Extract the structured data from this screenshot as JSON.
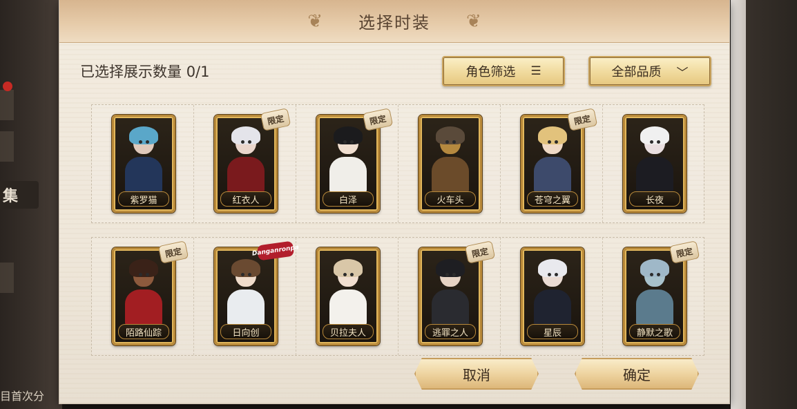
{
  "background": {
    "side_tab": "集",
    "bottom_text": "目首次分"
  },
  "dialog": {
    "title": "选择时装",
    "selected_label": "已选择展示数量",
    "selected_count": "0/1",
    "filter_button": "角色筛选",
    "quality_dropdown": "全部品质",
    "cancel": "取消",
    "confirm": "确定"
  },
  "badges": {
    "limited": "限定",
    "collab": "Danganronpa"
  },
  "costumes": [
    {
      "name": "紫罗猫",
      "badge": "",
      "hair": "#5aa7c9",
      "body": "#23365a",
      "skin": "#dfc9bb"
    },
    {
      "name": "红衣人",
      "badge": "limited",
      "hair": "#e4e4ea",
      "body": "#7a1a1d",
      "skin": "#ead6cc"
    },
    {
      "name": "白泽",
      "badge": "limited",
      "hair": "#1b1b1d",
      "body": "#f0eee9",
      "skin": "#f1dfd0"
    },
    {
      "name": "火车头",
      "badge": "",
      "hair": "#5a4a3a",
      "body": "#6b4b2a",
      "skin": "#b5893f"
    },
    {
      "name": "苍穹之翼",
      "badge": "limited",
      "hair": "#e2c27c",
      "body": "#3d4a6b",
      "skin": "#f0dac6"
    },
    {
      "name": "长夜",
      "badge": "",
      "hair": "#f0f0f0",
      "body": "#1c1c22",
      "skin": "#e9dfe0"
    },
    {
      "name": "陌路仙踪",
      "badge": "limited",
      "hair": "#3a2218",
      "body": "#a21e22",
      "skin": "#8d5a3d"
    },
    {
      "name": "日向创",
      "badge": "collab",
      "hair": "#6a4a31",
      "body": "#e9ecef",
      "skin": "#f0dccb"
    },
    {
      "name": "贝拉夫人",
      "badge": "",
      "hair": "#d9c7a8",
      "body": "#f3f1ec",
      "skin": "#f1dfd0"
    },
    {
      "name": "逃罪之人",
      "badge": "limited",
      "hair": "#1e1e22",
      "body": "#2a2b30",
      "skin": "#e6d3c4"
    },
    {
      "name": "星辰",
      "badge": "",
      "hair": "#e9e9ee",
      "body": "#1f2330",
      "skin": "#ebdcd4"
    },
    {
      "name": "静默之歌",
      "badge": "limited",
      "hair": "#9fb8c8",
      "body": "#5b7b8d",
      "skin": "#a8c2cc"
    }
  ]
}
